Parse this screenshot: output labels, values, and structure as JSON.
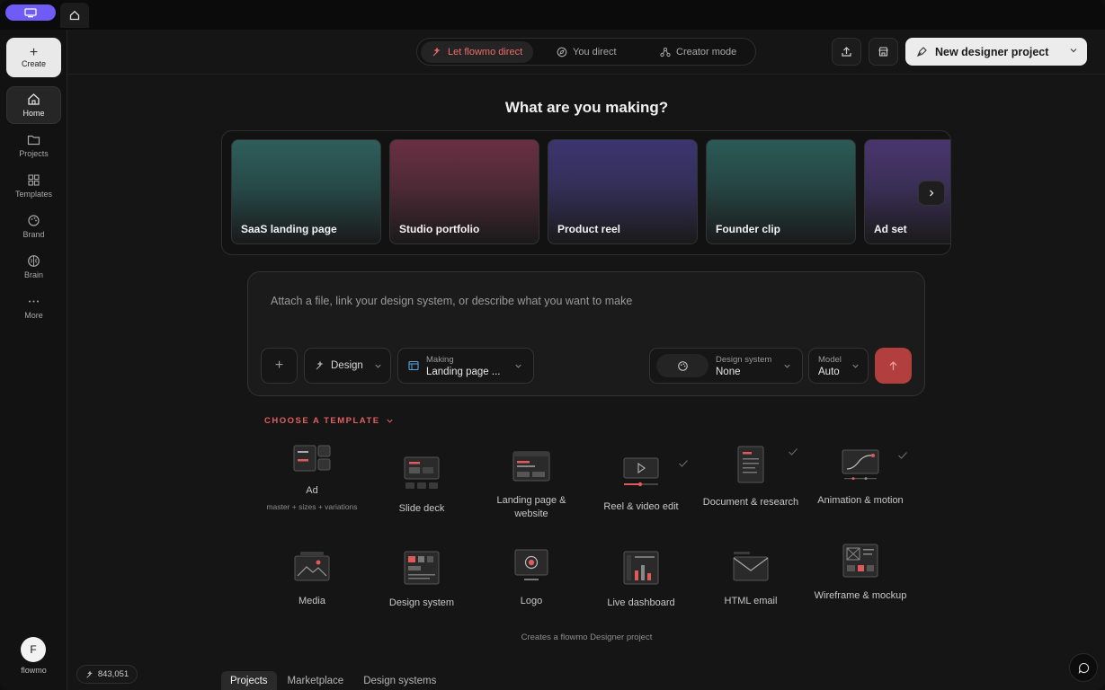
{
  "sidebar": {
    "create_label": "Create",
    "items": [
      {
        "label": "Home",
        "icon": "home-icon"
      },
      {
        "label": "Projects",
        "icon": "folder-icon"
      },
      {
        "label": "Templates",
        "icon": "grid-icon"
      },
      {
        "label": "Brand",
        "icon": "palette-icon"
      },
      {
        "label": "Brain",
        "icon": "brain-icon"
      },
      {
        "label": "More",
        "icon": "more-icon"
      }
    ],
    "user_initial": "F",
    "user_name": "flowmo"
  },
  "header": {
    "modes": [
      {
        "label": "Let flowmo direct",
        "active": true
      },
      {
        "label": "You direct",
        "active": false
      },
      {
        "label": "Creator mode",
        "active": false
      }
    ],
    "new_project_label": "New designer project"
  },
  "main": {
    "heading": "What are you making?",
    "cards": [
      {
        "label": "SaaS landing page",
        "color": "#2f5e5b"
      },
      {
        "label": "Studio portfolio",
        "color": "#6a2f43"
      },
      {
        "label": "Product reel",
        "color": "#3b3570"
      },
      {
        "label": "Founder clip",
        "color": "#2b5a56"
      },
      {
        "label": "Ad set",
        "color": "#4a356e"
      }
    ],
    "prompt": {
      "placeholder": "Attach a file, link your design system, or describe what you want to make",
      "design_label": "Design",
      "making_caption": "Making",
      "making_value": "Landing page ...",
      "design_system_caption": "Design system",
      "design_system_value": "None",
      "model_caption": "Model",
      "model_value": "Auto"
    },
    "choose_template_label": "CHOOSE A TEMPLATE",
    "templates": [
      {
        "label": "Ad",
        "sub": "master + sizes + variations"
      },
      {
        "label": "Slide deck"
      },
      {
        "label": "Landing page & website"
      },
      {
        "label": "Reel & video edit"
      },
      {
        "label": "Document & research"
      },
      {
        "label": "Animation & motion"
      },
      {
        "label": "Media"
      },
      {
        "label": "Design system"
      },
      {
        "label": "Logo"
      },
      {
        "label": "Live dashboard"
      },
      {
        "label": "HTML email"
      },
      {
        "label": "Wireframe & mockup"
      }
    ],
    "creates_note": "Creates a flowmo Designer project",
    "credits": "843,051",
    "bottom_tabs": [
      {
        "label": "Projects",
        "active": true
      },
      {
        "label": "Marketplace",
        "active": false
      },
      {
        "label": "Design systems",
        "active": false
      }
    ]
  },
  "colors": {
    "accent": "#ef6b6b",
    "send": "#b33e3e",
    "app_chip": "#6f5cf6"
  }
}
